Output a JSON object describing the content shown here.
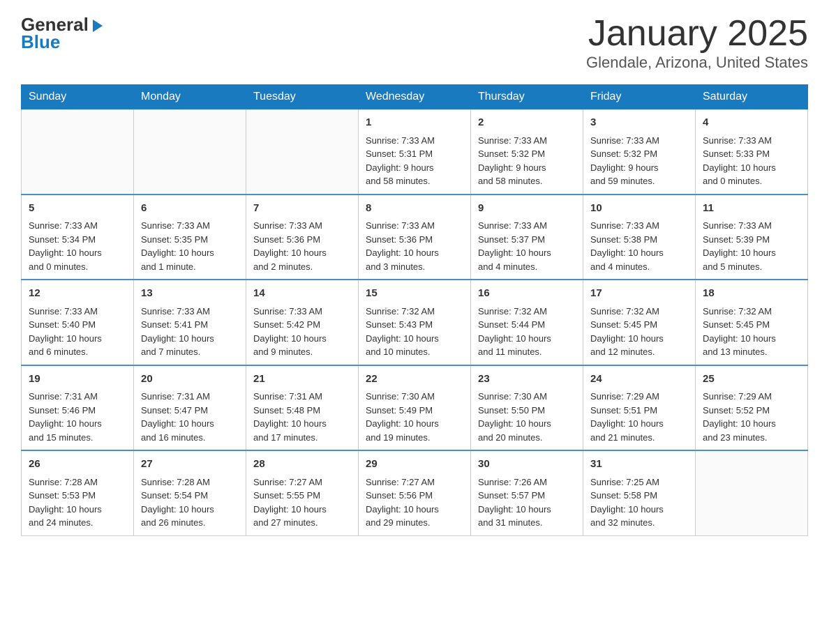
{
  "logo": {
    "general": "General",
    "arrow": "▶",
    "blue": "Blue"
  },
  "title": "January 2025",
  "subtitle": "Glendale, Arizona, United States",
  "days_of_week": [
    "Sunday",
    "Monday",
    "Tuesday",
    "Wednesday",
    "Thursday",
    "Friday",
    "Saturday"
  ],
  "weeks": [
    [
      {
        "day": "",
        "info": ""
      },
      {
        "day": "",
        "info": ""
      },
      {
        "day": "",
        "info": ""
      },
      {
        "day": "1",
        "info": "Sunrise: 7:33 AM\nSunset: 5:31 PM\nDaylight: 9 hours\nand 58 minutes."
      },
      {
        "day": "2",
        "info": "Sunrise: 7:33 AM\nSunset: 5:32 PM\nDaylight: 9 hours\nand 58 minutes."
      },
      {
        "day": "3",
        "info": "Sunrise: 7:33 AM\nSunset: 5:32 PM\nDaylight: 9 hours\nand 59 minutes."
      },
      {
        "day": "4",
        "info": "Sunrise: 7:33 AM\nSunset: 5:33 PM\nDaylight: 10 hours\nand 0 minutes."
      }
    ],
    [
      {
        "day": "5",
        "info": "Sunrise: 7:33 AM\nSunset: 5:34 PM\nDaylight: 10 hours\nand 0 minutes."
      },
      {
        "day": "6",
        "info": "Sunrise: 7:33 AM\nSunset: 5:35 PM\nDaylight: 10 hours\nand 1 minute."
      },
      {
        "day": "7",
        "info": "Sunrise: 7:33 AM\nSunset: 5:36 PM\nDaylight: 10 hours\nand 2 minutes."
      },
      {
        "day": "8",
        "info": "Sunrise: 7:33 AM\nSunset: 5:36 PM\nDaylight: 10 hours\nand 3 minutes."
      },
      {
        "day": "9",
        "info": "Sunrise: 7:33 AM\nSunset: 5:37 PM\nDaylight: 10 hours\nand 4 minutes."
      },
      {
        "day": "10",
        "info": "Sunrise: 7:33 AM\nSunset: 5:38 PM\nDaylight: 10 hours\nand 4 minutes."
      },
      {
        "day": "11",
        "info": "Sunrise: 7:33 AM\nSunset: 5:39 PM\nDaylight: 10 hours\nand 5 minutes."
      }
    ],
    [
      {
        "day": "12",
        "info": "Sunrise: 7:33 AM\nSunset: 5:40 PM\nDaylight: 10 hours\nand 6 minutes."
      },
      {
        "day": "13",
        "info": "Sunrise: 7:33 AM\nSunset: 5:41 PM\nDaylight: 10 hours\nand 7 minutes."
      },
      {
        "day": "14",
        "info": "Sunrise: 7:33 AM\nSunset: 5:42 PM\nDaylight: 10 hours\nand 9 minutes."
      },
      {
        "day": "15",
        "info": "Sunrise: 7:32 AM\nSunset: 5:43 PM\nDaylight: 10 hours\nand 10 minutes."
      },
      {
        "day": "16",
        "info": "Sunrise: 7:32 AM\nSunset: 5:44 PM\nDaylight: 10 hours\nand 11 minutes."
      },
      {
        "day": "17",
        "info": "Sunrise: 7:32 AM\nSunset: 5:45 PM\nDaylight: 10 hours\nand 12 minutes."
      },
      {
        "day": "18",
        "info": "Sunrise: 7:32 AM\nSunset: 5:45 PM\nDaylight: 10 hours\nand 13 minutes."
      }
    ],
    [
      {
        "day": "19",
        "info": "Sunrise: 7:31 AM\nSunset: 5:46 PM\nDaylight: 10 hours\nand 15 minutes."
      },
      {
        "day": "20",
        "info": "Sunrise: 7:31 AM\nSunset: 5:47 PM\nDaylight: 10 hours\nand 16 minutes."
      },
      {
        "day": "21",
        "info": "Sunrise: 7:31 AM\nSunset: 5:48 PM\nDaylight: 10 hours\nand 17 minutes."
      },
      {
        "day": "22",
        "info": "Sunrise: 7:30 AM\nSunset: 5:49 PM\nDaylight: 10 hours\nand 19 minutes."
      },
      {
        "day": "23",
        "info": "Sunrise: 7:30 AM\nSunset: 5:50 PM\nDaylight: 10 hours\nand 20 minutes."
      },
      {
        "day": "24",
        "info": "Sunrise: 7:29 AM\nSunset: 5:51 PM\nDaylight: 10 hours\nand 21 minutes."
      },
      {
        "day": "25",
        "info": "Sunrise: 7:29 AM\nSunset: 5:52 PM\nDaylight: 10 hours\nand 23 minutes."
      }
    ],
    [
      {
        "day": "26",
        "info": "Sunrise: 7:28 AM\nSunset: 5:53 PM\nDaylight: 10 hours\nand 24 minutes."
      },
      {
        "day": "27",
        "info": "Sunrise: 7:28 AM\nSunset: 5:54 PM\nDaylight: 10 hours\nand 26 minutes."
      },
      {
        "day": "28",
        "info": "Sunrise: 7:27 AM\nSunset: 5:55 PM\nDaylight: 10 hours\nand 27 minutes."
      },
      {
        "day": "29",
        "info": "Sunrise: 7:27 AM\nSunset: 5:56 PM\nDaylight: 10 hours\nand 29 minutes."
      },
      {
        "day": "30",
        "info": "Sunrise: 7:26 AM\nSunset: 5:57 PM\nDaylight: 10 hours\nand 31 minutes."
      },
      {
        "day": "31",
        "info": "Sunrise: 7:25 AM\nSunset: 5:58 PM\nDaylight: 10 hours\nand 32 minutes."
      },
      {
        "day": "",
        "info": ""
      }
    ]
  ]
}
